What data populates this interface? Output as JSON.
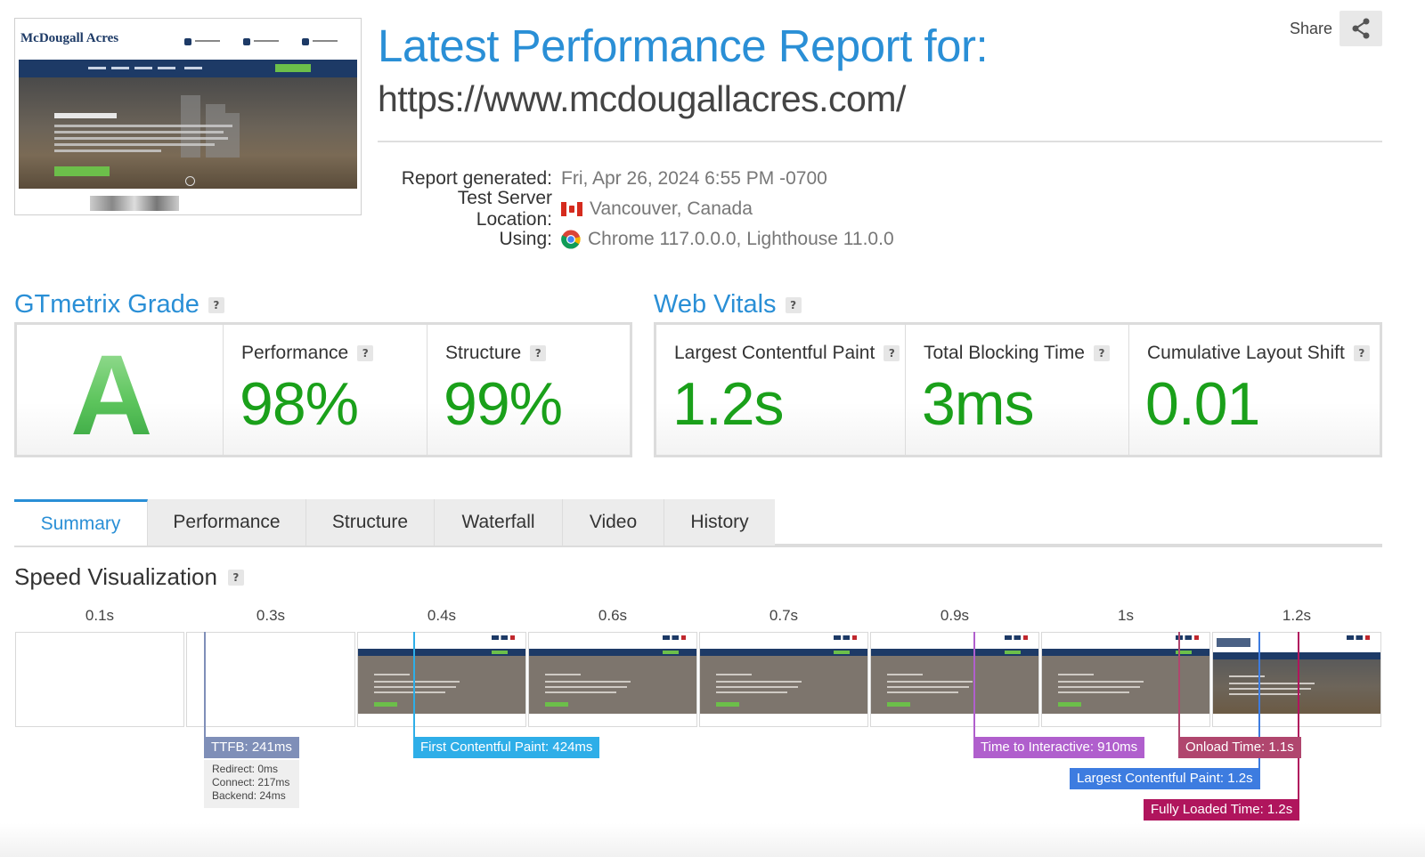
{
  "header": {
    "title": "Latest Performance Report for:",
    "url": "https://www.mcdougallacres.com/",
    "share_label": "Share",
    "thumbnail": {
      "logo_text": "McDougall Acres"
    },
    "meta": [
      {
        "key": "Report generated:",
        "value": "Fri, Apr 26, 2024 6:55 PM -0700",
        "icon": "none"
      },
      {
        "key": "Test Server Location:",
        "value": "Vancouver, Canada",
        "icon": "canada-flag-icon"
      },
      {
        "key": "Using:",
        "value": "Chrome 117.0.0.0, Lighthouse 11.0.0",
        "icon": "chrome-icon"
      }
    ]
  },
  "grade": {
    "title": "GTmetrix Grade",
    "help": "?",
    "letter": "A",
    "performance": {
      "label": "Performance",
      "value": "98%"
    },
    "structure": {
      "label": "Structure",
      "value": "99%"
    }
  },
  "web_vitals": {
    "title": "Web Vitals",
    "help": "?",
    "lcp": {
      "label": "Largest Contentful Paint",
      "value": "1.2s"
    },
    "tbt": {
      "label": "Total Blocking Time",
      "value": "3ms"
    },
    "cls": {
      "label": "Cumulative Layout Shift",
      "value": "0.01"
    }
  },
  "tabs": [
    {
      "label": "Summary",
      "active": true
    },
    {
      "label": "Performance",
      "active": false
    },
    {
      "label": "Structure",
      "active": false
    },
    {
      "label": "Waterfall",
      "active": false
    },
    {
      "label": "Video",
      "active": false
    },
    {
      "label": "History",
      "active": false
    }
  ],
  "speed_visualization": {
    "title": "Speed Visualization",
    "help": "?",
    "frame_times": [
      "0.1s",
      "0.3s",
      "0.4s",
      "0.6s",
      "0.7s",
      "0.9s",
      "1s",
      "1.2s"
    ],
    "markers": {
      "ttfb": {
        "label": "TTFB: 241ms",
        "color": "#7f8fb8",
        "details": {
          "redirect": "Redirect: 0ms",
          "connect": "Connect: 217ms",
          "backend": "Backend: 24ms"
        }
      },
      "fcp": {
        "label": "First Contentful Paint: 424ms",
        "color": "#2eaee8"
      },
      "tti": {
        "label": "Time to Interactive: 910ms",
        "color": "#b05fcd"
      },
      "onload": {
        "label": "Onload Time: 1.1s",
        "color": "#b0466e"
      },
      "lcp": {
        "label": "Largest Contentful Paint: 1.2s",
        "color": "#3d7ce0"
      },
      "fully_loaded": {
        "label": "Fully Loaded Time: 1.2s",
        "color": "#b0155d"
      }
    }
  },
  "colors": {
    "accent": "#2a8fd6",
    "grade_green": "#1aa01a"
  }
}
